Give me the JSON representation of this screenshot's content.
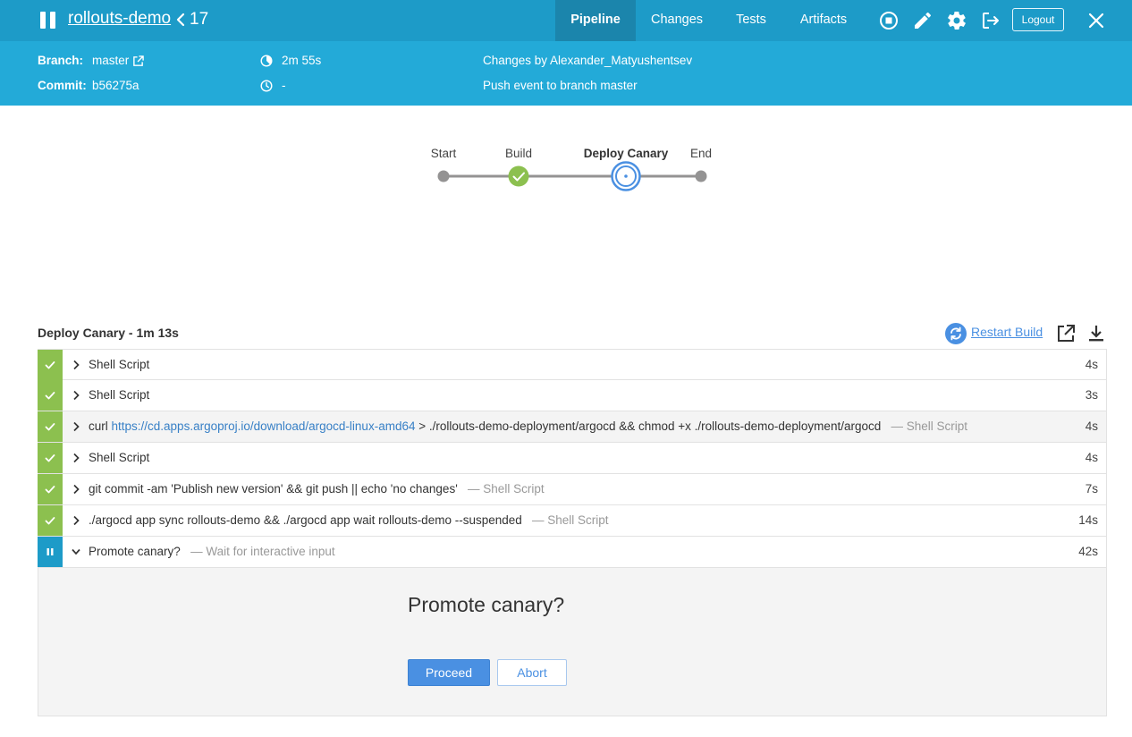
{
  "header": {
    "pipeline_name": "rollouts-demo",
    "run_number": "17",
    "tabs": [
      {
        "label": "Pipeline",
        "active": true
      },
      {
        "label": "Changes",
        "active": false
      },
      {
        "label": "Tests",
        "active": false
      },
      {
        "label": "Artifacts",
        "active": false
      }
    ],
    "logout_label": "Logout",
    "icons": [
      "pause-icon",
      "stop-icon",
      "edit-icon",
      "gear-icon",
      "exit-icon",
      "close-icon"
    ],
    "background_color": "#1d9bc8"
  },
  "info": {
    "branch_label": "Branch:",
    "branch_value": "master",
    "commit_label": "Commit:",
    "commit_value": "b56275a",
    "duration": "2m 55s",
    "started": "-",
    "changes_by": "Changes by Alexander_Matyushentsev",
    "cause": "Push event to branch master",
    "background_color": "#23aad8"
  },
  "graph": {
    "stages": [
      {
        "label": "Start",
        "state": "node"
      },
      {
        "label": "Build",
        "state": "success"
      },
      {
        "label": "Deploy Canary",
        "state": "running",
        "selected": true
      },
      {
        "label": "End",
        "state": "node"
      }
    ],
    "success_color": "#8cc04f",
    "running_color": "#4a90e2"
  },
  "stage_detail": {
    "title": "Deploy Canary - 1m 13s",
    "restart_label": "Restart Build",
    "steps": [
      {
        "status": "success",
        "expanded": false,
        "text": "Shell Script",
        "link": "",
        "after": "",
        "sub": "",
        "duration": "4s"
      },
      {
        "status": "success",
        "expanded": false,
        "text": "Shell Script",
        "link": "",
        "after": "",
        "sub": "",
        "duration": "3s"
      },
      {
        "status": "success",
        "expanded": false,
        "text": "curl ",
        "link": "https://cd.apps.argoproj.io/download/argocd-linux-amd64",
        "after": " > ./rollouts-demo-deployment/argocd && chmod +x ./rollouts-demo-deployment/argocd",
        "sub": "— Shell Script",
        "duration": "4s",
        "highlighted": true
      },
      {
        "status": "success",
        "expanded": false,
        "text": "Shell Script",
        "link": "",
        "after": "",
        "sub": "",
        "duration": "4s"
      },
      {
        "status": "success",
        "expanded": false,
        "text": "git commit -am 'Publish new version' && git push || echo 'no changes'",
        "link": "",
        "after": "",
        "sub": "— Shell Script",
        "duration": "7s"
      },
      {
        "status": "success",
        "expanded": false,
        "text": "./argocd app sync rollouts-demo && ./argocd app wait rollouts-demo --suspended",
        "link": "",
        "after": "",
        "sub": "— Shell Script",
        "duration": "14s"
      },
      {
        "status": "paused",
        "expanded": true,
        "text": "Promote canary?",
        "link": "",
        "after": "",
        "sub": "— Wait for interactive input",
        "duration": "42s"
      }
    ],
    "input": {
      "message": "Promote canary?",
      "proceed_label": "Proceed",
      "abort_label": "Abort"
    }
  }
}
